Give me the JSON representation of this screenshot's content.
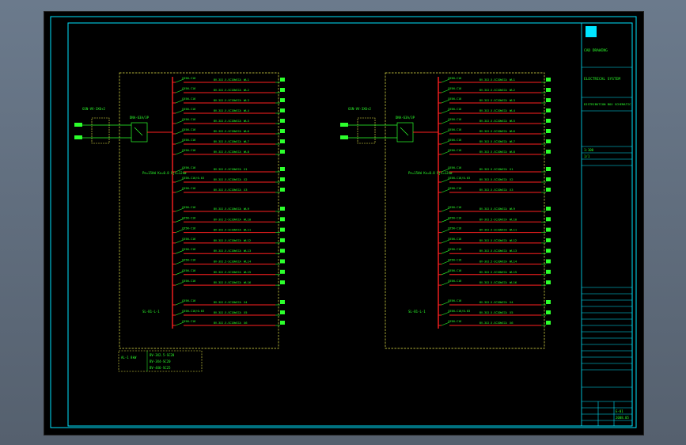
{
  "colors": {
    "frame": "#00e5ff",
    "busbar": "#ff2020",
    "dashed_box": "#e8e84a",
    "text": "#2cff2c",
    "background": "#000000"
  },
  "panel_left": {
    "incoming_cable": "GSN-VV-3X6+2",
    "main_breaker": "DNA-63A/3P",
    "outgoing_label": "SL-B1-L-1",
    "left_note": "Pe=15kW Kx=0.8 Pjs=12kW",
    "group1": [
      {
        "breaker": "C65N-C16",
        "cable": "BV-3X2.5-SC20WCCA",
        "circuit": "WL1"
      },
      {
        "breaker": "C65N-C16",
        "cable": "BV-3X2.5-SC20WCCA",
        "circuit": "WL2"
      },
      {
        "breaker": "C65N-C16",
        "cable": "BV-3X2.5-SC20WCCA",
        "circuit": "WL3"
      },
      {
        "breaker": "C65N-C16",
        "cable": "BV-3X2.5-SC20WCCA",
        "circuit": "WL4"
      },
      {
        "breaker": "C65N-C16",
        "cable": "BV-3X2.5-SC20WCCA",
        "circuit": "WL5"
      },
      {
        "breaker": "C65N-C16",
        "cable": "BV-3X2.5-SC20WCCA",
        "circuit": "WL6"
      },
      {
        "breaker": "C65N-C16",
        "cable": "BV-3X2.5-SC20WCCA",
        "circuit": "WL7"
      },
      {
        "breaker": "C65N-C16",
        "cable": "BV-3X2.5-SC20WCCA",
        "circuit": "WL8"
      }
    ],
    "group2": [
      {
        "breaker": "C65N-C16",
        "cable": "BV-3X2.5-SC20WCCA",
        "circuit": "WL9"
      },
      {
        "breaker": "C65N-C16",
        "cable": "BV-3X2.5-SC20WCCA",
        "circuit": "WL10"
      },
      {
        "breaker": "C65N-C16",
        "cable": "BV-3X2.5-SC20WCCA",
        "circuit": "WL11"
      },
      {
        "breaker": "C65N-C16",
        "cable": "BV-3X2.5-SC20WCCA",
        "circuit": "WL12"
      },
      {
        "breaker": "C65N-C16",
        "cable": "BV-3X2.5-SC20WCCA",
        "circuit": "WL13"
      },
      {
        "breaker": "C65N-C16",
        "cable": "BV-3X2.5-SC20WCCA",
        "circuit": "WL14"
      },
      {
        "breaker": "C65N-C16",
        "cable": "BV-3X2.5-SC20WCCA",
        "circuit": "WL15"
      },
      {
        "breaker": "C65N-C16",
        "cable": "BV-3X2.5-SC20WCCA",
        "circuit": "WL16"
      }
    ],
    "sockets_a": [
      {
        "breaker": "C65N-C16",
        "cable": "BV-3X2.5-SC20WCCA",
        "circuit": "X1"
      },
      {
        "breaker": "C65N-C16/0.03",
        "cable": "BV-3X2.5-SC20WCCA",
        "circuit": "X2"
      },
      {
        "breaker": "C65N-C16",
        "cable": "BV-3X2.5-SC20WCCA",
        "circuit": "X3"
      }
    ],
    "sockets_b": [
      {
        "breaker": "C65N-C16",
        "cable": "BV-3X2.5-SC20WCCA",
        "circuit": "X4"
      },
      {
        "breaker": "C65N-C16/0.03",
        "cable": "BV-3X2.5-SC20WCCA",
        "circuit": "X5"
      },
      {
        "breaker": "C65N-C16",
        "cable": "BV-3X2.5-SC20WCCA",
        "circuit": "X6"
      }
    ]
  },
  "panel_right": {
    "incoming_cable": "GSN-VV-3X6+2",
    "main_breaker": "DNA-63A/3P",
    "outgoing_label": "SL-B1-L-1",
    "left_note": "Pe=15kW Kx=0.8 Pjs=12kW",
    "group1": [
      {
        "breaker": "C65N-C16",
        "cable": "BV-3X2.5-SC20WCCA",
        "circuit": "WL1"
      },
      {
        "breaker": "C65N-C16",
        "cable": "BV-3X2.5-SC20WCCA",
        "circuit": "WL2"
      },
      {
        "breaker": "C65N-C16",
        "cable": "BV-3X2.5-SC20WCCA",
        "circuit": "WL3"
      },
      {
        "breaker": "C65N-C16",
        "cable": "BV-3X2.5-SC20WCCA",
        "circuit": "WL4"
      },
      {
        "breaker": "C65N-C16",
        "cable": "BV-3X2.5-SC20WCCA",
        "circuit": "WL5"
      },
      {
        "breaker": "C65N-C16",
        "cable": "BV-3X2.5-SC20WCCA",
        "circuit": "WL6"
      },
      {
        "breaker": "C65N-C16",
        "cable": "BV-3X2.5-SC20WCCA",
        "circuit": "WL7"
      },
      {
        "breaker": "C65N-C16",
        "cable": "BV-3X2.5-SC20WCCA",
        "circuit": "WL8"
      }
    ],
    "group2": [
      {
        "breaker": "C65N-C16",
        "cable": "BV-3X2.5-SC20WCCA",
        "circuit": "WL9"
      },
      {
        "breaker": "C65N-C16",
        "cable": "BV-3X2.5-SC20WCCA",
        "circuit": "WL10"
      },
      {
        "breaker": "C65N-C16",
        "cable": "BV-3X2.5-SC20WCCA",
        "circuit": "WL11"
      },
      {
        "breaker": "C65N-C16",
        "cable": "BV-3X2.5-SC20WCCA",
        "circuit": "WL12"
      },
      {
        "breaker": "C65N-C16",
        "cable": "BV-3X2.5-SC20WCCA",
        "circuit": "WL13"
      },
      {
        "breaker": "C65N-C16",
        "cable": "BV-3X2.5-SC20WCCA",
        "circuit": "WL14"
      },
      {
        "breaker": "C65N-C16",
        "cable": "BV-3X2.5-SC20WCCA",
        "circuit": "WL15"
      },
      {
        "breaker": "C65N-C16",
        "cable": "BV-3X2.5-SC20WCCA",
        "circuit": "WL16"
      }
    ],
    "sockets_a": [
      {
        "breaker": "C65N-C16",
        "cable": "BV-3X2.5-SC20WCCA",
        "circuit": "X1"
      },
      {
        "breaker": "C65N-C16/0.03",
        "cable": "BV-3X2.5-SC20WCCA",
        "circuit": "X2"
      },
      {
        "breaker": "C65N-C16",
        "cable": "BV-3X2.5-SC20WCCA",
        "circuit": "X3"
      }
    ],
    "sockets_b": [
      {
        "breaker": "C65N-C16",
        "cable": "BV-3X2.5-SC20WCCA",
        "circuit": "X4"
      },
      {
        "breaker": "C65N-C16/0.03",
        "cable": "BV-3X2.5-SC20WCCA",
        "circuit": "X5"
      },
      {
        "breaker": "C65N-C16",
        "cable": "BV-3X2.5-SC20WCCA",
        "circuit": "X6"
      }
    ]
  },
  "legend": {
    "rows": [
      "BV-3X2.5-SC20",
      "BV-3X4-SC20",
      "BV-4X6-SC25"
    ],
    "left_text": "AL-1 8kW"
  },
  "title_block": {
    "company": "CAD DRAWING",
    "project": "ELECTRICAL SYSTEM",
    "drawing_title": "DISTRIBUTION BOX SCHEMATIC",
    "scale": "1:100",
    "sheet": "1/1",
    "drawing_no": "E-01",
    "date": "2008.05"
  }
}
